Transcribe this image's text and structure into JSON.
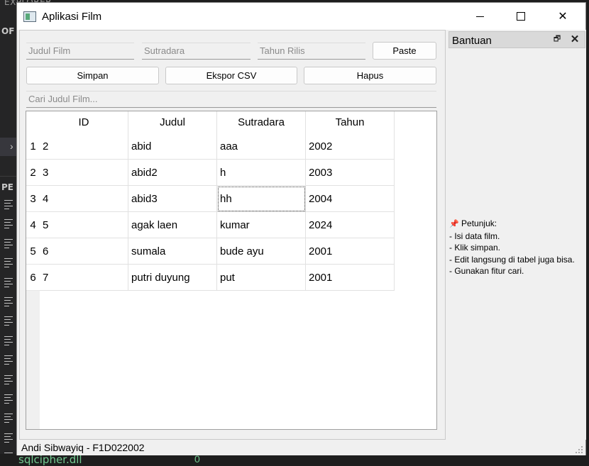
{
  "background_ide": {
    "explorer_label": "EXPLORER",
    "open_editors_abbr": "OF",
    "section_abbr": "PE",
    "file_name": "sqlcipher.dll",
    "file_badge": "0"
  },
  "window": {
    "title": "Aplikasi Film"
  },
  "form": {
    "title_placeholder": "Judul Film",
    "director_placeholder": "Sutradara",
    "year_placeholder": "Tahun Rilis",
    "paste_label": "Paste",
    "save_label": "Simpan",
    "export_label": "Ekspor CSV",
    "delete_label": "Hapus",
    "search_placeholder": "Cari Judul Film..."
  },
  "table": {
    "columns": [
      "ID",
      "Judul",
      "Sutradara",
      "Tahun"
    ],
    "rows": [
      {
        "num": "1",
        "cells": [
          "2",
          "abid",
          "aaa",
          "2002"
        ]
      },
      {
        "num": "2",
        "cells": [
          "3",
          "abid2",
          "h",
          "2003"
        ]
      },
      {
        "num": "3",
        "cells": [
          "4",
          "abid3",
          "hh",
          "2004"
        ]
      },
      {
        "num": "4",
        "cells": [
          "5",
          "agak laen",
          "kumar",
          "2024"
        ]
      },
      {
        "num": "5",
        "cells": [
          "6",
          "sumala",
          "bude ayu",
          "2001"
        ]
      },
      {
        "num": "6",
        "cells": [
          "7",
          "putri duyung",
          "put",
          "2001"
        ]
      }
    ]
  },
  "dock": {
    "title": "Bantuan",
    "help_heading": "Petunjuk:",
    "help_lines": [
      "- Isi data film.",
      "- Klik simpan.",
      "- Edit langsung di tabel juga bisa.",
      "- Gunakan fitur cari."
    ]
  },
  "status": {
    "text": "Andi Sibwayiq - F1D022002"
  }
}
